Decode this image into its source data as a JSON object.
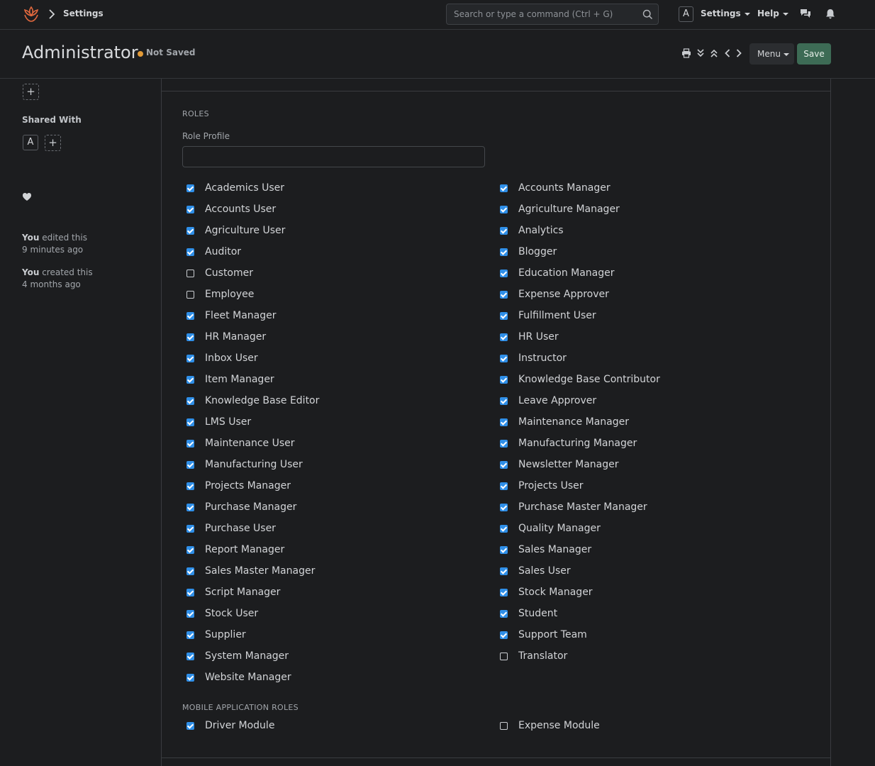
{
  "navbar": {
    "breadcrumb": "Settings",
    "search_placeholder": "Search or type a command (Ctrl + G)",
    "avatar_initial": "A",
    "settings_label": "Settings",
    "help_label": "Help"
  },
  "header": {
    "title": "Administrator",
    "status": "Not Saved",
    "menu_label": "Menu",
    "save_label": "Save"
  },
  "sidebar": {
    "shared_with_label": "Shared With",
    "shared_avatar_initial": "A",
    "activity": [
      {
        "who": "You",
        "action": " edited this",
        "when": "9 minutes ago"
      },
      {
        "who": "You",
        "action": " created this",
        "when": "4 months ago"
      }
    ]
  },
  "roles_section": {
    "heading": "ROLES",
    "role_profile_label": "Role Profile",
    "role_profile_value": "",
    "left": [
      {
        "label": "Academics User",
        "checked": true
      },
      {
        "label": "Accounts User",
        "checked": true
      },
      {
        "label": "Agriculture User",
        "checked": true
      },
      {
        "label": "Auditor",
        "checked": true
      },
      {
        "label": "Customer",
        "checked": false
      },
      {
        "label": "Employee",
        "checked": false
      },
      {
        "label": "Fleet Manager",
        "checked": true
      },
      {
        "label": "HR Manager",
        "checked": true
      },
      {
        "label": "Inbox User",
        "checked": true
      },
      {
        "label": "Item Manager",
        "checked": true
      },
      {
        "label": "Knowledge Base Editor",
        "checked": true
      },
      {
        "label": "LMS User",
        "checked": true
      },
      {
        "label": "Maintenance User",
        "checked": true
      },
      {
        "label": "Manufacturing User",
        "checked": true
      },
      {
        "label": "Projects Manager",
        "checked": true
      },
      {
        "label": "Purchase Manager",
        "checked": true
      },
      {
        "label": "Purchase User",
        "checked": true
      },
      {
        "label": "Report Manager",
        "checked": true
      },
      {
        "label": "Sales Master Manager",
        "checked": true
      },
      {
        "label": "Script Manager",
        "checked": true
      },
      {
        "label": "Stock User",
        "checked": true
      },
      {
        "label": "Supplier",
        "checked": true
      },
      {
        "label": "System Manager",
        "checked": true
      },
      {
        "label": "Website Manager",
        "checked": true
      }
    ],
    "right": [
      {
        "label": "Accounts Manager",
        "checked": true
      },
      {
        "label": "Agriculture Manager",
        "checked": true
      },
      {
        "label": "Analytics",
        "checked": true
      },
      {
        "label": "Blogger",
        "checked": true
      },
      {
        "label": "Education Manager",
        "checked": true
      },
      {
        "label": "Expense Approver",
        "checked": true
      },
      {
        "label": "Fulfillment User",
        "checked": true
      },
      {
        "label": "HR User",
        "checked": true
      },
      {
        "label": "Instructor",
        "checked": true
      },
      {
        "label": "Knowledge Base Contributor",
        "checked": true
      },
      {
        "label": "Leave Approver",
        "checked": true
      },
      {
        "label": "Maintenance Manager",
        "checked": true
      },
      {
        "label": "Manufacturing Manager",
        "checked": true
      },
      {
        "label": "Newsletter Manager",
        "checked": true
      },
      {
        "label": "Projects User",
        "checked": true
      },
      {
        "label": "Purchase Master Manager",
        "checked": true
      },
      {
        "label": "Quality Manager",
        "checked": true
      },
      {
        "label": "Sales Manager",
        "checked": true
      },
      {
        "label": "Sales User",
        "checked": true
      },
      {
        "label": "Stock Manager",
        "checked": true
      },
      {
        "label": "Student",
        "checked": true
      },
      {
        "label": "Support Team",
        "checked": true
      },
      {
        "label": "Translator",
        "checked": false
      }
    ]
  },
  "mobile_section": {
    "heading": "MOBILE APPLICATION ROLES",
    "left": [
      {
        "label": "Driver Module",
        "checked": true
      }
    ],
    "right": [
      {
        "label": "Expense Module",
        "checked": false
      }
    ]
  },
  "colors": {
    "background": "#1c1d1f",
    "checkbox_on": "#2f8fe8",
    "save_button": "#3d6b55",
    "status_dot": "#e29a37"
  }
}
